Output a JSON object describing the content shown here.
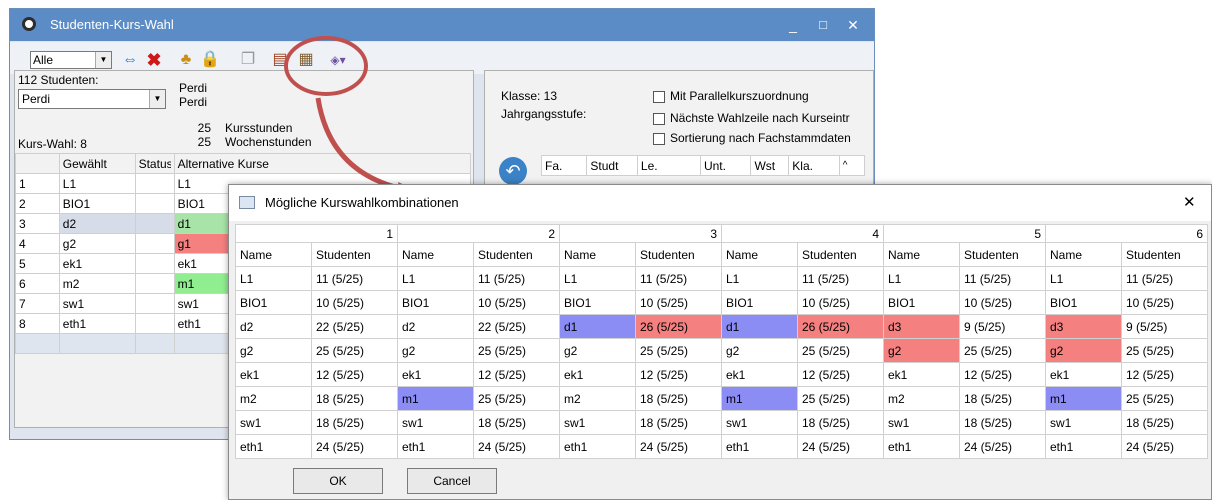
{
  "main_window": {
    "title": "Studenten-Kurs-Wahl",
    "minimize": "_",
    "maximize": "□",
    "close": "✕"
  },
  "toolbar": {
    "filter_value": "Alle",
    "icons": [
      "swap-icon",
      "delete-icon",
      "group-icon",
      "lock-icon",
      "copy-icon",
      "course-print-icon",
      "course-combination-icon",
      "more-icon"
    ]
  },
  "left": {
    "students_count_label": "112 Studenten:",
    "student_select_value": "Perdi",
    "student_name_1": "Perdi",
    "student_name_2": "Perdi",
    "kursstunden_num": "25",
    "kursstunden_label": "Kursstunden",
    "wochenstunden_num": "25",
    "wochenstunden_label": "Wochenstunden",
    "kurswahl_label": "Kurs-Wahl: 8",
    "columns": [
      "Gewählt",
      "Status",
      "Alternative Kurse"
    ],
    "rows": [
      {
        "n": "1",
        "gewaehlt": "L1",
        "alt": "L1"
      },
      {
        "n": "2",
        "gewaehlt": "BIO1",
        "alt": "BIO1"
      },
      {
        "n": "3",
        "gewaehlt": "d2",
        "alt": "d1"
      },
      {
        "n": "4",
        "gewaehlt": "g2",
        "alt": "g1"
      },
      {
        "n": "5",
        "gewaehlt": "ek1",
        "alt": "ek1"
      },
      {
        "n": "6",
        "gewaehlt": "m2",
        "alt": "m1"
      },
      {
        "n": "7",
        "gewaehlt": "sw1",
        "alt": "sw1"
      },
      {
        "n": "8",
        "gewaehlt": "eth1",
        "alt": "eth1"
      }
    ]
  },
  "right": {
    "klasse_label": "Klasse: 13",
    "jahrgang_label": "Jahrgangsstufe:",
    "option_1": "Mit Parallelkurszuordnung",
    "option_2": "Nächste Wahlzeile nach Kurseintr",
    "option_3": "Sortierung nach Fachstammdaten",
    "columns": [
      "Fa.",
      "Studt",
      "Le.",
      "Unt.",
      "Wst",
      "Kla."
    ]
  },
  "dialog": {
    "title": "Mögliche Kurswahlkombinationen",
    "close": "✕",
    "combos": [
      "1",
      "2",
      "3",
      "4",
      "5",
      "6"
    ],
    "name_header": "Name",
    "students_header": "Studenten",
    "rows": [
      [
        [
          "L1",
          "11 (5/25)"
        ],
        [
          "L1",
          "11 (5/25)"
        ],
        [
          "L1",
          "11 (5/25)"
        ],
        [
          "L1",
          "11 (5/25)"
        ],
        [
          "L1",
          "11 (5/25)"
        ],
        [
          "L1",
          "11 (5/25)"
        ]
      ],
      [
        [
          "BIO1",
          "10 (5/25)"
        ],
        [
          "BIO1",
          "10 (5/25)"
        ],
        [
          "BIO1",
          "10 (5/25)"
        ],
        [
          "BIO1",
          "10 (5/25)"
        ],
        [
          "BIO1",
          "10 (5/25)"
        ],
        [
          "BIO1",
          "10 (5/25)"
        ]
      ],
      [
        [
          "d2",
          "22 (5/25)"
        ],
        [
          "d2",
          "22 (5/25)"
        ],
        [
          "d1",
          "26 (5/25)"
        ],
        [
          "d1",
          "26 (5/25)"
        ],
        [
          "d3",
          "9 (5/25)"
        ],
        [
          "d3",
          "9 (5/25)"
        ]
      ],
      [
        [
          "g2",
          "25 (5/25)"
        ],
        [
          "g2",
          "25 (5/25)"
        ],
        [
          "g2",
          "25 (5/25)"
        ],
        [
          "g2",
          "25 (5/25)"
        ],
        [
          "g2",
          "25 (5/25)"
        ],
        [
          "g2",
          "25 (5/25)"
        ]
      ],
      [
        [
          "ek1",
          "12 (5/25)"
        ],
        [
          "ek1",
          "12 (5/25)"
        ],
        [
          "ek1",
          "12 (5/25)"
        ],
        [
          "ek1",
          "12 (5/25)"
        ],
        [
          "ek1",
          "12 (5/25)"
        ],
        [
          "ek1",
          "12 (5/25)"
        ]
      ],
      [
        [
          "m2",
          "18 (5/25)"
        ],
        [
          "m1",
          "25 (5/25)"
        ],
        [
          "m2",
          "18 (5/25)"
        ],
        [
          "m1",
          "25 (5/25)"
        ],
        [
          "m2",
          "18 (5/25)"
        ],
        [
          "m1",
          "25 (5/25)"
        ]
      ],
      [
        [
          "sw1",
          "18 (5/25)"
        ],
        [
          "sw1",
          "18 (5/25)"
        ],
        [
          "sw1",
          "18 (5/25)"
        ],
        [
          "sw1",
          "18 (5/25)"
        ],
        [
          "sw1",
          "18 (5/25)"
        ],
        [
          "sw1",
          "18 (5/25)"
        ]
      ],
      [
        [
          "eth1",
          "24 (5/25)"
        ],
        [
          "eth1",
          "24 (5/25)"
        ],
        [
          "eth1",
          "24 (5/25)"
        ],
        [
          "eth1",
          "24 (5/25)"
        ],
        [
          "eth1",
          "24 (5/25)"
        ],
        [
          "eth1",
          "24 (5/25)"
        ]
      ]
    ],
    "ok_label": "OK",
    "cancel_label": "Cancel"
  },
  "colors": {
    "blue_highlight": "#8c8cf5",
    "red_highlight": "#f58080",
    "green_highlight": "#90ee90",
    "annotation": "#c0504d"
  }
}
